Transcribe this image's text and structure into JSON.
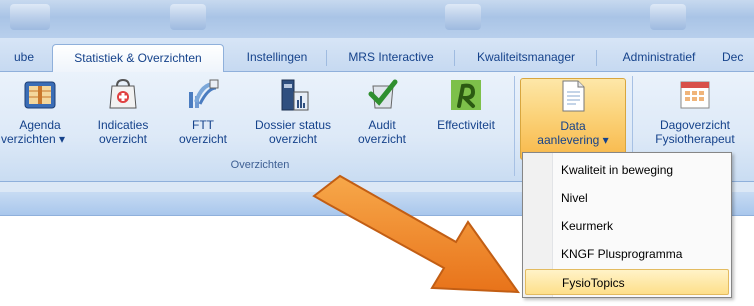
{
  "tabs": [
    {
      "label": "ube",
      "active": false
    },
    {
      "label": "Statistiek & Overzichten",
      "active": true
    },
    {
      "label": "Instellingen",
      "active": false
    },
    {
      "label": "MRS Interactive",
      "active": false
    },
    {
      "label": "Kwaliteitsmanager",
      "active": false
    },
    {
      "label": "Administratief",
      "active": false
    },
    {
      "label": "Dec",
      "active": false
    }
  ],
  "ribbon": {
    "buttons": [
      {
        "line1": "Agenda",
        "line2": "verzichten ▾",
        "icon": "agenda-icon"
      },
      {
        "line1": "Indicaties",
        "line2": "overzicht",
        "icon": "indicaties-icon"
      },
      {
        "line1": "FTT",
        "line2": "overzicht",
        "icon": "ftt-icon"
      },
      {
        "line1": "Dossier status",
        "line2": "overzicht",
        "icon": "dossier-status-icon"
      },
      {
        "line1": "Audit",
        "line2": "overzicht",
        "icon": "audit-icon"
      },
      {
        "line1": "Effectiviteit",
        "line2": "",
        "icon": "effectiviteit-icon"
      },
      {
        "line1": "Data",
        "line2": "aanlevering ▾",
        "icon": "data-aanlevering-icon",
        "pressed": true
      },
      {
        "line1": "Dagoverzicht",
        "line2": "Fysiotherapeut",
        "icon": "dagoverzicht-icon"
      }
    ],
    "group_label": "Overzichten"
  },
  "dropdown": {
    "items": [
      {
        "label": "Kwaliteit in beweging",
        "highlighted": false
      },
      {
        "label": "Nivel",
        "highlighted": false
      },
      {
        "label": "Keurmerk",
        "highlighted": false
      },
      {
        "label": "KNGF Plusprogramma",
        "highlighted": false
      },
      {
        "label": "FysioTopics",
        "highlighted": true
      }
    ]
  },
  "colors": {
    "ribbon_text": "#15428b",
    "arrow": "#f08a24",
    "highlight": "#fedf8a"
  }
}
